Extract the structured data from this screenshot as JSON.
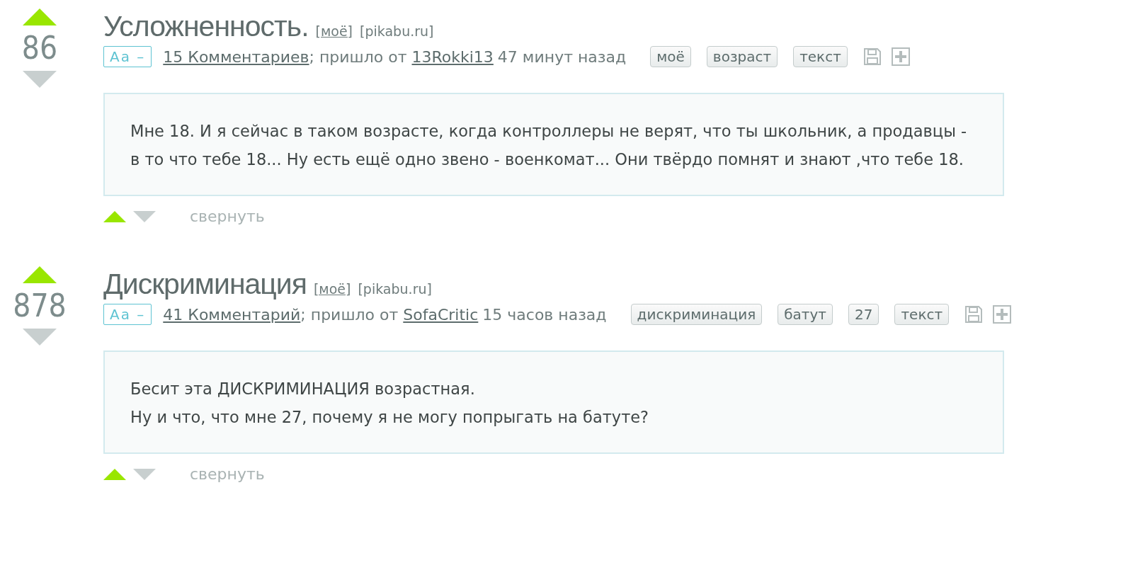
{
  "posts": [
    {
      "rating": "86",
      "title": "Усложненность.",
      "title_tags": [
        "[моё]",
        "[pikabu.ru]"
      ],
      "font_toggle": "Aa –",
      "comments": "15 Комментариев",
      "came_from": "; пришло от",
      "author": "13Rokki13",
      "time": "47 минут назад",
      "tags": [
        "моё",
        "возраст",
        "текст"
      ],
      "body": [
        "Мне 18. И я сейчас в таком возрасте, когда контроллеры не верят, что ты школьник, а продавцы - в то что тебе 18... Ну есть ещё одно звено - военкомат... Они твёрдо помнят и знают ,что тебе 18."
      ],
      "collapse": "свернуть"
    },
    {
      "rating": "878",
      "title": "Дискриминация",
      "title_tags": [
        "[моё]",
        "[pikabu.ru]"
      ],
      "font_toggle": "Aa –",
      "comments": "41 Комментарий",
      "came_from": "; пришло от",
      "author": "SofaCritic",
      "time": "15 часов назад",
      "tags": [
        "дискриминация",
        "батут",
        "27",
        "текст"
      ],
      "body": [
        "Бесит эта ДИСКРИМИНАЦИЯ возрастная.",
        "Ну и что, что мне 27, почему я не могу попрыгать на батуте?"
      ],
      "collapse": "свернуть"
    }
  ]
}
